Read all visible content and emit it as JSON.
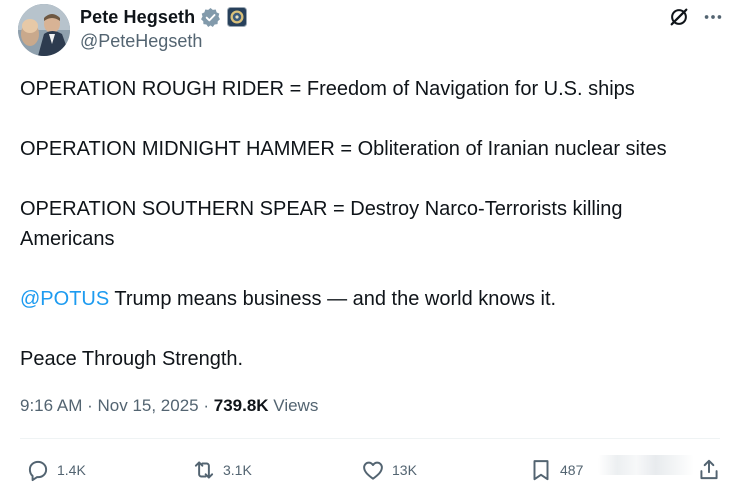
{
  "author": {
    "display_name": "Pete Hegseth",
    "handle": "@PeteHegseth",
    "verified_color": "#829aab",
    "avatar_icon": "avatar-photo",
    "affiliate_icon": "department-seal-icon"
  },
  "tweet": {
    "paragraphs": [
      "OPERATION ROUGH RIDER = Freedom of Navigation for U.S. ships",
      "OPERATION MIDNIGHT HAMMER = Obliteration of Iranian nuclear sites",
      "OPERATION SOUTHERN SPEAR = Destroy Narco-Terrorists killing Americans"
    ],
    "mention": "@POTUS",
    "mention_rest": " Trump means business — and the world knows it.",
    "closing": "Peace Through Strength.",
    "mention_color": "#1d9bf0"
  },
  "meta": {
    "time": "9:16 AM",
    "separator": " · ",
    "date": "Nov 15, 2025",
    "views_count": "739.8K",
    "views_label": "Views"
  },
  "actions": {
    "replies": "1.4K",
    "reposts": "3.1K",
    "likes": "13K",
    "bookmarks": "487"
  }
}
